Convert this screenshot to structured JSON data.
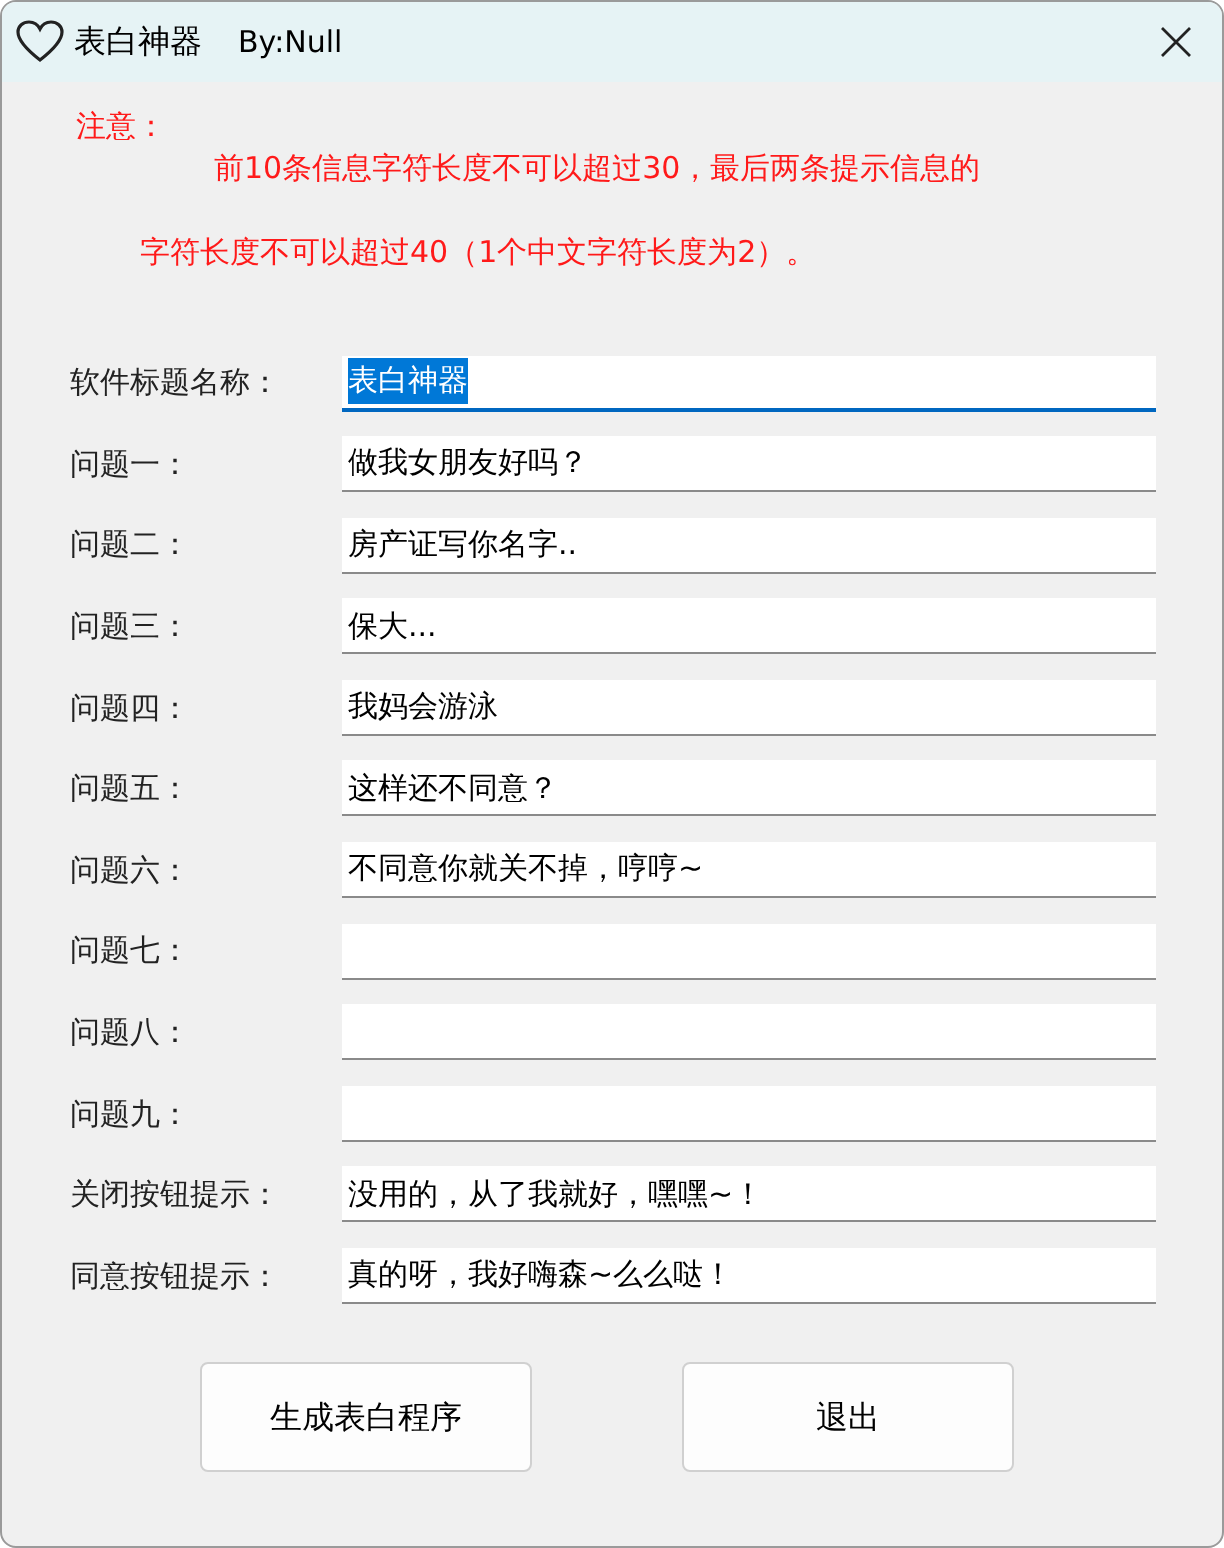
{
  "window": {
    "title": "表白神器",
    "subtitle": "By:Null"
  },
  "notice": {
    "heading": "注意：",
    "lines": [
      "前10条信息字符长度不可以超过30，最后两条提示信息的",
      "字符长度不可以超过40（1个中文字符长度为2）。"
    ]
  },
  "fields": [
    {
      "label": "软件标题名称：",
      "value": "表白神器",
      "focused": true
    },
    {
      "label": "问题一：",
      "value": "做我女朋友好吗？",
      "focused": false
    },
    {
      "label": "问题二：",
      "value": "房产证写你名字..",
      "focused": false
    },
    {
      "label": "问题三：",
      "value": "保大...",
      "focused": false
    },
    {
      "label": "问题四：",
      "value": "我妈会游泳",
      "focused": false
    },
    {
      "label": "问题五：",
      "value": "这样还不同意？",
      "focused": false
    },
    {
      "label": "问题六：",
      "value": "不同意你就关不掉，哼哼~",
      "focused": false
    },
    {
      "label": "问题七：",
      "focused": false
    },
    {
      "label": "问题八：",
      "focused": false
    },
    {
      "label": "问题九：",
      "focused": false
    },
    {
      "label": "关闭按钮提示：",
      "value": "没用的，从了我就好，嘿嘿~！",
      "focused": false
    },
    {
      "label": "同意按钮提示：",
      "value": "真的呀，我好嗨森~么么哒！",
      "focused": false
    }
  ],
  "buttons": [
    "生成表白程序",
    "退出"
  ]
}
